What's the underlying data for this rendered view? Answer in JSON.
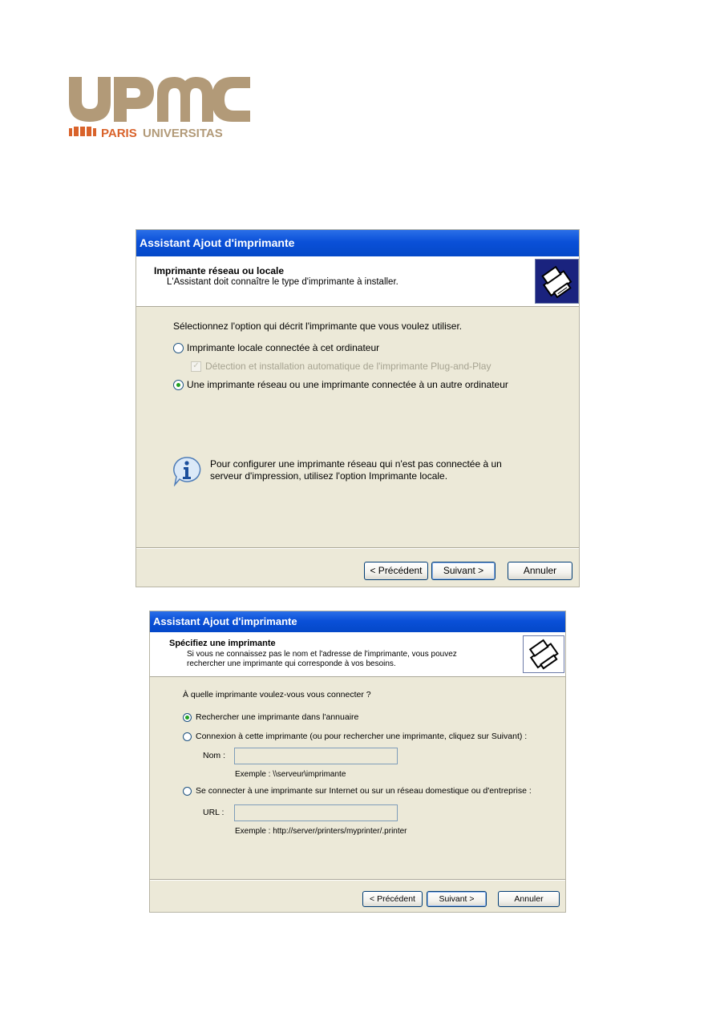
{
  "logo": {
    "upmc": "UPMC",
    "tagline_paris": "PARIS",
    "tagline_universitas": "UNIVERSITAS",
    "colors": {
      "gold": "#b29a78",
      "orange": "#d9622a"
    }
  },
  "dialog1": {
    "title": "Assistant Ajout d'imprimante",
    "header_title": "Imprimante réseau ou locale",
    "header_subtitle": "L'Assistant doit connaître le type d'imprimante à installer.",
    "prompt": "Sélectionnez l'option qui décrit l'imprimante que vous voulez utiliser.",
    "option_local": "Imprimante locale connectée à cet ordinateur",
    "checkbox_pnp": "Détection et installation automatique de l'imprimante Plug-and-Play",
    "option_network": "Une imprimante réseau ou une imprimante connectée à un autre ordinateur",
    "info_line1": "Pour configurer une imprimante réseau qui n'est pas connectée à un",
    "info_line2": "serveur d'impression, utilisez l'option Imprimante locale.",
    "btn_back": "< Précédent",
    "btn_next": "Suivant >",
    "btn_cancel": "Annuler"
  },
  "dialog2": {
    "title": "Assistant Ajout d'imprimante",
    "header_title": "Spécifiez une imprimante",
    "header_subtitle_line1": "Si vous ne connaissez pas le nom et l'adresse de l'imprimante, vous pouvez",
    "header_subtitle_line2": "rechercher une imprimante qui corresponde à vos besoins.",
    "prompt": "À quelle imprimante voulez-vous vous connecter ?",
    "option_directory": "Rechercher une imprimante dans l'annuaire",
    "option_connect": "Connexion à cette imprimante (ou pour rechercher une imprimante, cliquez sur Suivant) :",
    "name_label": "Nom :",
    "name_example": "Exemple : \\\\serveur\\imprimante",
    "option_internet": "Se connecter à une imprimante sur Internet ou sur un réseau domestique ou d'entreprise :",
    "url_label": "URL :",
    "url_example": "Exemple : http://server/printers/myprinter/.printer",
    "btn_back": "< Précédent",
    "btn_next": "Suivant >",
    "btn_cancel": "Annuler"
  }
}
